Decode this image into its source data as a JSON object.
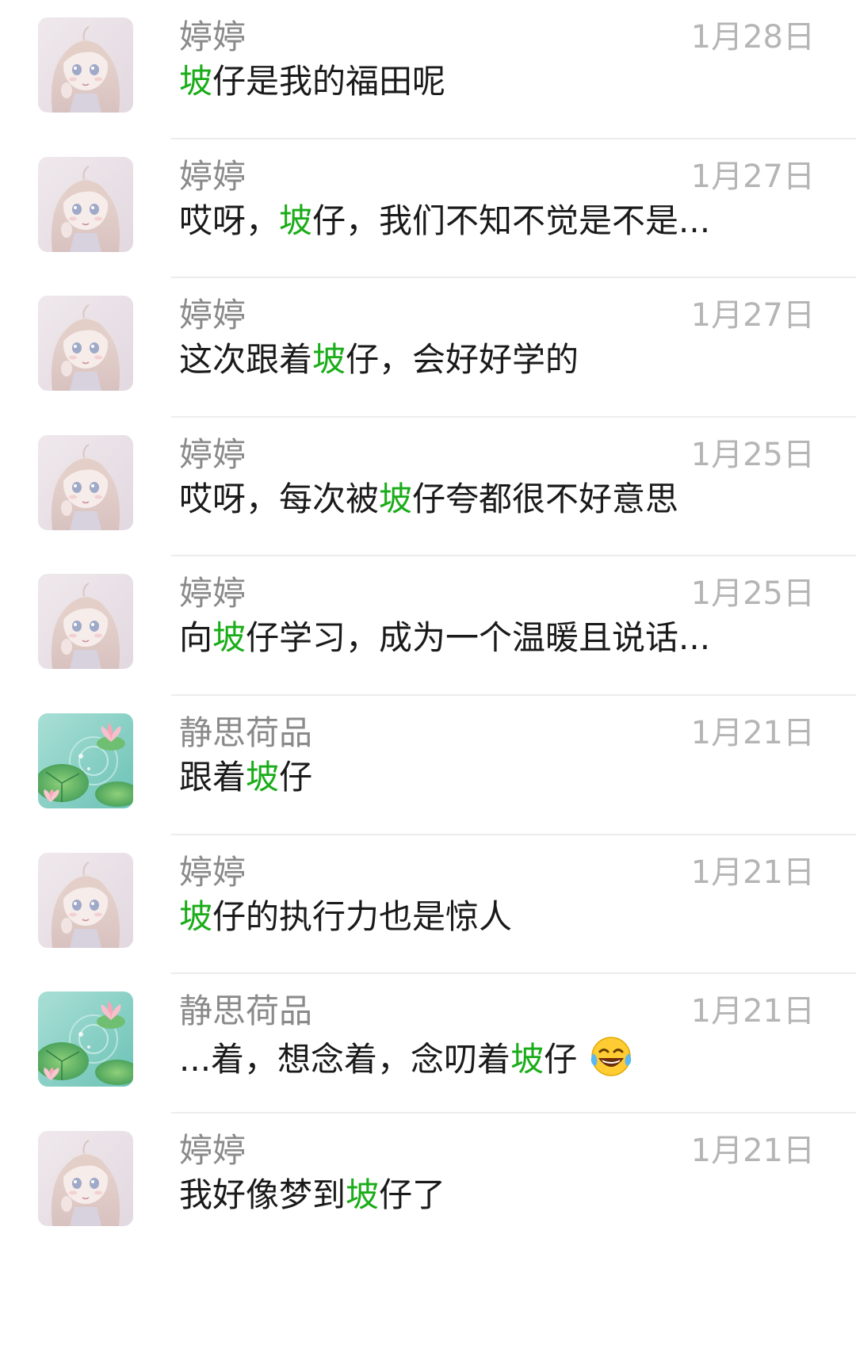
{
  "messages": [
    {
      "name": "婷婷",
      "date": "1月28日",
      "pre": "",
      "keyword": "坡",
      "post": "仔是我的福田呢",
      "avatar": "girl-avatar",
      "emoji": ""
    },
    {
      "name": "婷婷",
      "date": "1月27日",
      "pre": "哎呀，",
      "keyword": "坡",
      "post": "仔，我们不知不觉是不是...",
      "avatar": "girl-avatar",
      "emoji": ""
    },
    {
      "name": "婷婷",
      "date": "1月27日",
      "pre": "这次跟着",
      "keyword": "坡",
      "post": "仔，会好好学的",
      "avatar": "girl-avatar",
      "emoji": ""
    },
    {
      "name": "婷婷",
      "date": "1月25日",
      "pre": "哎呀，每次被",
      "keyword": "坡",
      "post": "仔夸都很不好意思",
      "avatar": "girl-avatar",
      "emoji": ""
    },
    {
      "name": "婷婷",
      "date": "1月25日",
      "pre": "向",
      "keyword": "坡",
      "post": "仔学习，成为一个温暖且说话...",
      "avatar": "girl-avatar",
      "emoji": ""
    },
    {
      "name": "静思荷品",
      "date": "1月21日",
      "pre": "跟着",
      "keyword": "坡",
      "post": "仔",
      "avatar": "lotus-avatar",
      "emoji": ""
    },
    {
      "name": "婷婷",
      "date": "1月21日",
      "pre": "",
      "keyword": "坡",
      "post": "仔的执行力也是惊人",
      "avatar": "girl-avatar",
      "emoji": ""
    },
    {
      "name": "静思荷品",
      "date": "1月21日",
      "pre": "...着，想念着，念叨着",
      "keyword": "坡",
      "post": "仔",
      "avatar": "lotus-avatar",
      "emoji": "laughing-tears-emoji"
    },
    {
      "name": "婷婷",
      "date": "1月21日",
      "pre": "我好像梦到",
      "keyword": "坡",
      "post": "仔了",
      "avatar": "girl-avatar",
      "emoji": ""
    }
  ],
  "colors": {
    "highlight": "#1aad19",
    "name": "#8a8a8a",
    "date": "#b5b5b5",
    "text": "#1a1a1a",
    "divider": "#ececec"
  }
}
